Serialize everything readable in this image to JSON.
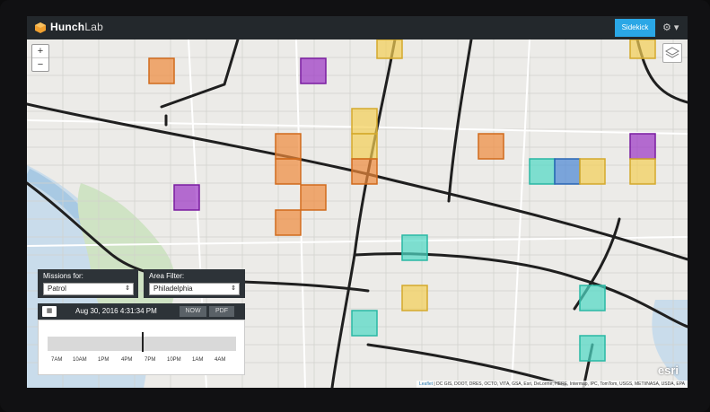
{
  "app": {
    "brand_main": "Hunch",
    "brand_sub": "Lab",
    "sidekick_label": "Sidekick",
    "settings_icon": "gear-icon"
  },
  "map": {
    "zoom_in": "+",
    "zoom_out": "−",
    "attribution_link": "Leaflet",
    "attribution_text": "| DC GIS, DOOT, DRES, OCTO, VITA, GSA, Esri, DeLorme, HERE, Intermap, IPC, TomTom, USGS, METI/NASA, USDA, EPA",
    "esri_logo": "esri"
  },
  "filters": {
    "missions_label": "Missions for:",
    "missions_value": "Patrol",
    "area_label": "Area Filter:",
    "area_value": "Philadelphia"
  },
  "time": {
    "datetime": "Aug 30, 2016 4:31:34 PM",
    "now_label": "NOW",
    "pdf_label": "PDF",
    "ticks": [
      "7AM",
      "10AM",
      "1PM",
      "4PM",
      "7PM",
      "10PM",
      "1AM",
      "4AM"
    ]
  },
  "colors": {
    "orange": "#f08a3c",
    "purple": "#9b33c4",
    "yellow": "#f4cf55",
    "teal": "#4ed8c4",
    "blue": "#4a86d4"
  }
}
